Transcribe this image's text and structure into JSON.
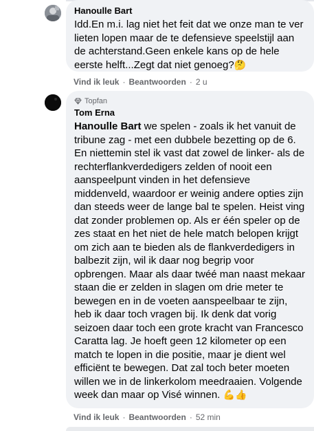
{
  "comments": [
    {
      "author": "Hanoulle Bart",
      "text": "Idd.En m.i. lag niet het feit dat we onze man te ver lieten lopen maar de te defensieve speelstijl aan de achterstand.Geen enkele kans op de hele eerste helft...Zegt dat niet genoeg?",
      "emoji": "🤔",
      "like_label": "Vind ik leuk",
      "reply_label": "Beantwoorden",
      "time": "2 u"
    },
    {
      "badge": "Topfan",
      "author": "Tom Erna",
      "mention": "Hanoulle Bart",
      "text": " we spelen - zoals ik het vanuit de tribune zag - met een dubbele bezetting op de 6. En niettemin stel ik vast dat zowel de linker- als de rechterflankverdedigers zelden of nooit een aanspeelpunt vinden in het defensieve middenveld, waardoor er weinig andere opties zijn dan steeds weer de lange bal te spelen. Heist ving dat zonder problemen op. Als er één speler op de zes staat en het niet de hele match belopen krijgt om zich aan te bieden als de flankverdedigers in balbezit zijn, wil ik daar nog begrip voor opbrengen. Maar als daar twéé man naast mekaar staan die er zelden in slagen om drie meter te bewegen en in de voeten aanspeelbaar te zijn, heb ik daar toch vragen bij. Ik denk dat vorig seizoen daar toch een grote kracht van Francesco Caratta lag. Je hoeft geen 12 kilometer op een match te lopen in die positie, maar je dient wel efficiënt te bewegen. Dat zal toch beter moeten willen we in de linkerkolom meedraaien. Volgende week dan maar op Visé winnen. ",
      "emoji": "💪👍",
      "like_label": "Vind ik leuk",
      "reply_label": "Beantwoorden",
      "time": "52 min"
    }
  ],
  "icons": {
    "avatar_1": "avatar",
    "avatar_2": "avatar",
    "badge_icon": "diamond-icon"
  },
  "colors": {
    "bubble": "#f0f2f5",
    "meta": "#65676b",
    "text": "#050505"
  }
}
